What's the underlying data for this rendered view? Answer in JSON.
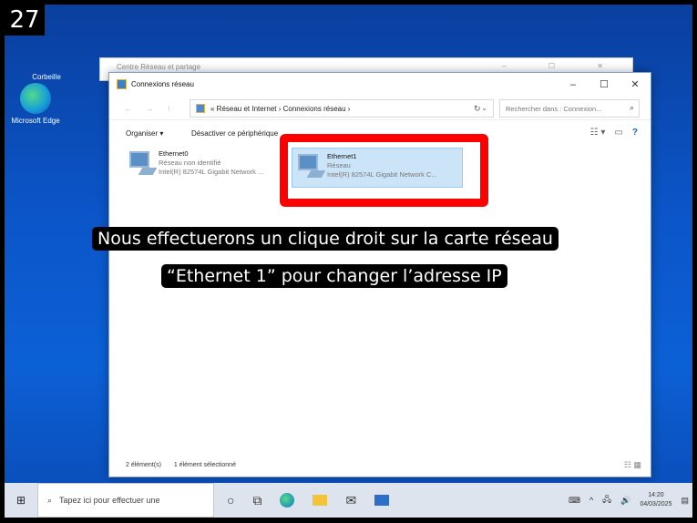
{
  "step_number": "27",
  "desktop": {
    "icons": [
      {
        "label": "Corbeille"
      },
      {
        "label": "Microsoft Edge"
      }
    ]
  },
  "back_window": {
    "title": "Centre Réseau et partage",
    "controls": "– ☐ ✕"
  },
  "window": {
    "title": "Connexions réseau",
    "controls": {
      "minimize": "–",
      "maximize": "☐",
      "close": "✕"
    },
    "nav": "← → ↑",
    "breadcrumb": "« Réseau et Internet › Connexions réseau ›",
    "search_placeholder": "Rechercher dans : Connexion...",
    "toolbar": {
      "organize": "Organiser ▾",
      "disable": "Désactiver ce périphérique"
    },
    "adapters": [
      {
        "name": "Ethernet0",
        "status": "Réseau non identifié",
        "device": "Intel(R) 82574L Gigabit Network ..."
      },
      {
        "name": "Ethernet1",
        "status": "Réseau",
        "device": "Intel(R) 82574L Gigabit Network C..."
      }
    ],
    "status": {
      "count": "2 élément(s)",
      "selected": "1 élément sélectionné"
    }
  },
  "caption": {
    "line1": "Nous effectuerons un clique droit sur la carte réseau",
    "line2": "“Ethernet 1” pour changer l’adresse IP"
  },
  "taskbar": {
    "search_placeholder": "Tapez ici pour effectuer une",
    "time": "14:20",
    "date": "04/03/2025"
  },
  "colors": {
    "highlight": "#ff0000",
    "selection": "#cce4f7",
    "desktop": "#0b55c8"
  }
}
